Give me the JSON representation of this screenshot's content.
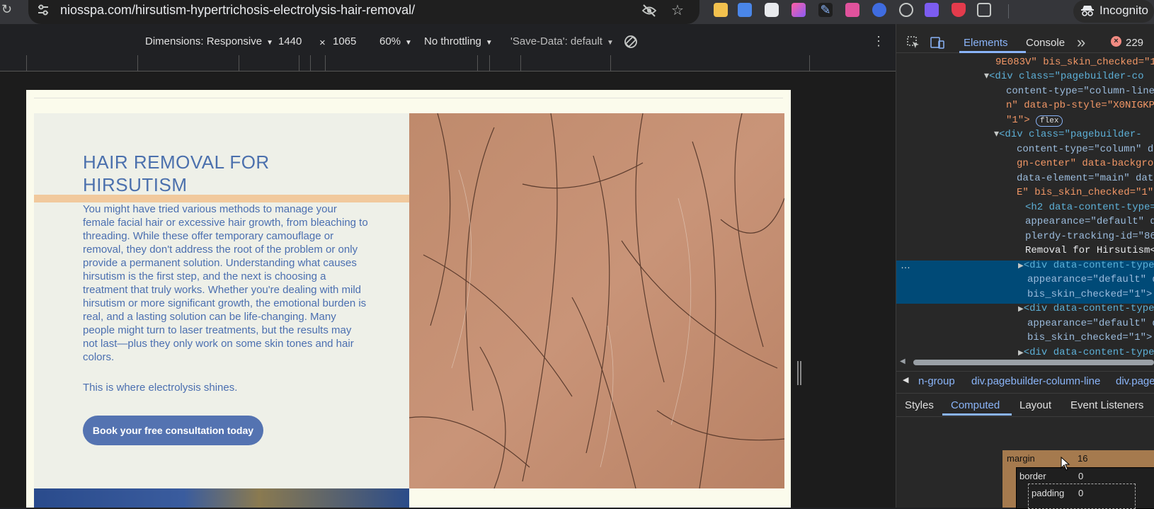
{
  "browser": {
    "url": "niosspa.com/hirsutism-hypertrichosis-electrolysis-hair-removal/",
    "incognito_label": "Incognito"
  },
  "device_toolbar": {
    "dimensions_label": "Dimensions: Responsive",
    "width": "1440",
    "times": "×",
    "height": "1065",
    "zoom": "60%",
    "throttling": "No throttling",
    "save_data": "'Save-Data': default"
  },
  "page": {
    "heading_line1": "HAIR REMOVAL FOR",
    "heading_line2": "HIRSUTISM",
    "body": "You might have tried various methods to manage your female facial hair or excessive hair growth, from bleaching to threading. While these offer temporary camouflage or removal, they don't address the root of the problem or only provide a permanent solution. Understanding what causes hirsutism is the first step, and the next is choosing a treatment that truly works. Whether you're dealing with mild hirsutism or more significant growth, the emotional burden is real, and a lasting solution can be life-changing. Many people might turn to laser treatments, but the results may not last—plus they only work on some skin tones and hair colors.",
    "shines": "This is where electrolysis shines.",
    "cta": "Book your free consultation today"
  },
  "devtools": {
    "tab_elements": "Elements",
    "tab_console": "Console",
    "more_tabs": "»",
    "error_count": "229",
    "dom_lines": [
      "9E083V\" bis_skin_checked=\"1",
      "<div class=\"pagebuilder-co",
      "content-type=\"column-line\"",
      "n\" data-pb-style=\"X0NIGKP\"",
      "\"1\">",
      "<div class=\"pagebuilder-",
      "content-type=\"column\" da",
      "gn-center\" data-backgrou",
      "data-element=\"main\" data",
      "E\" bis_skin_checked=\"1\">",
      "<h2 data-content-type=",
      "appearance=\"default\" d",
      "plerdy-tracking-id=\"86",
      "Removal for Hirsutism<",
      "<div data-content-type",
      "appearance=\"default\" d",
      "bis_skin_checked=\"1\">",
      "<div data-content-type",
      "appearance=\"default\" d",
      "bis_skin_checked=\"1\">",
      "<div data-content-type"
    ],
    "flex_badge": "flex",
    "breadcrumb": [
      "n-group",
      "div.pagebuilder-column-line",
      "div.page"
    ],
    "subtabs": [
      "Styles",
      "Computed",
      "Layout",
      "Event Listeners"
    ],
    "box_model": {
      "margin_label": "margin",
      "margin_value": "16",
      "border_label": "border",
      "border_value": "0",
      "padding_label": "padding",
      "padding_value": "0"
    }
  },
  "colors": {
    "heading": "#4b70ad",
    "cta_bg": "#5473b1",
    "accent_line": "#f1c99d",
    "devtools_selected": "#004a77"
  }
}
